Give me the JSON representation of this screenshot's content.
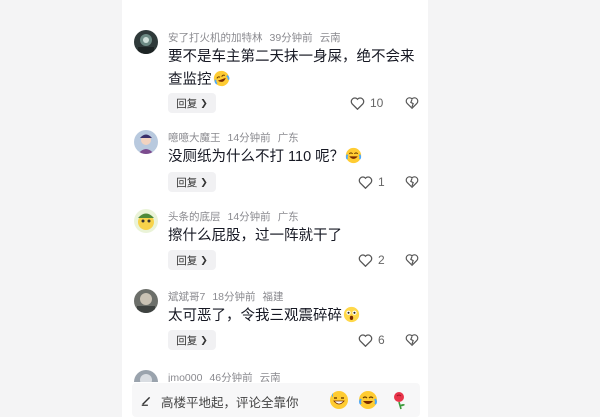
{
  "comments": [
    {
      "username": "安了打火机的加特林",
      "time": "39分钟前",
      "location": "云南",
      "text": "要不是车主第二天抹一身屎，绝不会来查监控",
      "reply_label": "回复",
      "likes": "10",
      "emoji": "laugh-tears-tilt"
    },
    {
      "username": "噫噫大魔王",
      "time": "14分钟前",
      "location": "广东",
      "text": "没厕纸为什么不打 110 呢？",
      "reply_label": "回复",
      "likes": "1",
      "emoji": "laugh-tears"
    },
    {
      "username": "头条的底层",
      "time": "14分钟前",
      "location": "广东",
      "text": "擦什么屁股，过一阵就干了",
      "reply_label": "回复",
      "likes": "2",
      "emoji": ""
    },
    {
      "username": "斌斌哥7",
      "time": "18分钟前",
      "location": "福建",
      "text": "太可恶了，令我三观震碎碎",
      "reply_label": "回复",
      "likes": "6",
      "emoji": "shocked"
    }
  ],
  "partial_comment": {
    "username": "jmo000",
    "time": "46分钟前",
    "location": "云南"
  },
  "input": {
    "placeholder": "高楼平地起，评论全靠你"
  },
  "quick_emojis": [
    "grin-sweat-emoji",
    "laugh-tears-emoji",
    "rose-emoji"
  ]
}
